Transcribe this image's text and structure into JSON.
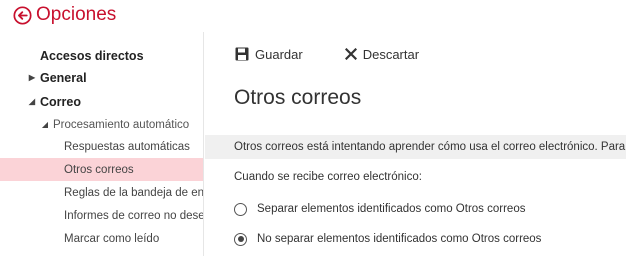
{
  "header": {
    "title": "Opciones",
    "back_icon": "back-arrow-circle-icon",
    "accent_color": "#c8102e"
  },
  "nav": {
    "items": [
      {
        "label": "Accesos directos",
        "level": 0,
        "caret": "",
        "selected": false
      },
      {
        "label": "General",
        "level": 1,
        "caret": "collapsed",
        "selected": false
      },
      {
        "label": "Correo",
        "level": 1,
        "caret": "expanded",
        "selected": false
      },
      {
        "label": "Procesamiento automático",
        "level": 2,
        "caret": "expanded",
        "selected": false
      },
      {
        "label": "Respuestas automáticas",
        "level": 3,
        "caret": "",
        "selected": false
      },
      {
        "label": "Otros correos",
        "level": 3,
        "caret": "",
        "selected": true
      },
      {
        "label": "Reglas de la bandeja de entrada",
        "level": 3,
        "caret": "",
        "selected": false
      },
      {
        "label": "Informes de correo no deseado",
        "level": 3,
        "caret": "",
        "selected": false
      },
      {
        "label": "Marcar como leído",
        "level": 3,
        "caret": "",
        "selected": false
      }
    ],
    "selected_color": "#fbd3d7"
  },
  "toolbar": {
    "save_label": "Guardar",
    "save_icon": "save-disk-icon",
    "discard_label": "Descartar",
    "discard_icon": "close-x-icon"
  },
  "main": {
    "title": "Otros correos",
    "info_text": "Otros correos está intentando aprender cómo usa el correo electrónico. Para",
    "subhead": "Cuando se recibe correo electrónico:",
    "options": [
      {
        "label": "Separar elementos identificados como Otros correos",
        "checked": false
      },
      {
        "label": "No separar elementos identificados como Otros correos",
        "checked": true
      }
    ]
  }
}
